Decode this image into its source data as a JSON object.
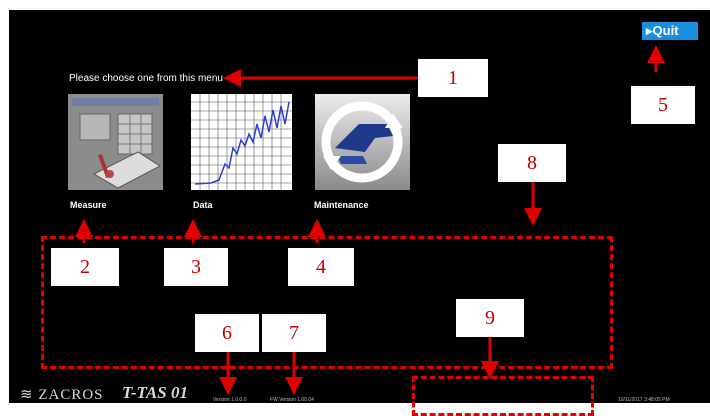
{
  "quit_label": "▸Quit",
  "prompt": "Please choose one from this menu",
  "menu": [
    {
      "label": "Measure"
    },
    {
      "label": "Data"
    },
    {
      "label": "Maintenance"
    }
  ],
  "callouts": [
    "1",
    "2",
    "3",
    "4",
    "5",
    "6",
    "7",
    "8",
    "9"
  ],
  "footer": {
    "logo": "ZACROS",
    "logo2": "T-TAS 01",
    "version": "Version 1.0.0.0",
    "fw_version": "FW Version 1.00.04",
    "datetime": "10/11/2017 3:48:05 PM"
  },
  "colors": {
    "screen_bg": "#000000",
    "quit_bg": "#1a8fe0",
    "annotation": "#e00000"
  }
}
